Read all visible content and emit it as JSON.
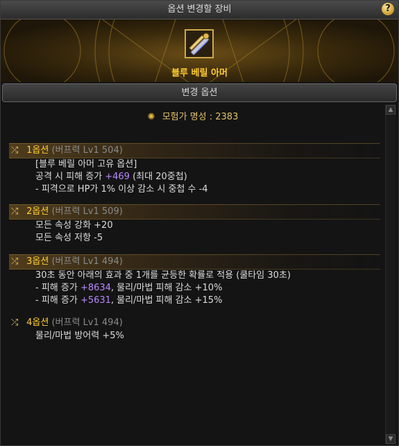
{
  "window": {
    "title": "옵션 변경할 장비",
    "help_label": "?"
  },
  "equipment": {
    "name": "블루 베릴 아머",
    "icon": "armor-item-icon"
  },
  "section": {
    "title": "변경 옵션"
  },
  "adventurer": {
    "icon": "adventurer-fame-icon",
    "label": "모험가 명성 : 2383"
  },
  "options": [
    {
      "name": "1옵션",
      "sub": "(버프력 Lv1 504)",
      "lines": [
        {
          "text": "[블루 베릴 아머 고유 옵션]"
        },
        {
          "pre": "공격 시 피해 증가 ",
          "hl": "+469",
          "post": " (최대 20중첩)"
        },
        {
          "text": "- 피격으로 HP가 1% 이상 감소 시 중첩 수 -4"
        }
      ]
    },
    {
      "name": "2옵션",
      "sub": "(버프력 Lv1 509)",
      "lines": [
        {
          "text": "모든 속성 강화 +20"
        },
        {
          "text": "모든 속성 저항 -5"
        }
      ]
    },
    {
      "name": "3옵션",
      "sub": "(버프력 Lv1 494)",
      "lines": [
        {
          "text": "30초 동안 아래의 효과 중 1개를 균등한 확률로 적용 (쿨타임 30초)"
        },
        {
          "pre": "- 피해 증가 ",
          "hl": "+8634",
          "post": ", 물리/마법 피해 감소 +10%"
        },
        {
          "pre": "- 피해 증가 ",
          "hl": "+5631",
          "post": ", 물리/마법 피해 감소 +15%"
        }
      ]
    },
    {
      "name": "4옵션",
      "sub": "(버프력 Lv1 494)",
      "lines": [
        {
          "text": "물리/마법 방어력 +5%"
        }
      ]
    }
  ]
}
